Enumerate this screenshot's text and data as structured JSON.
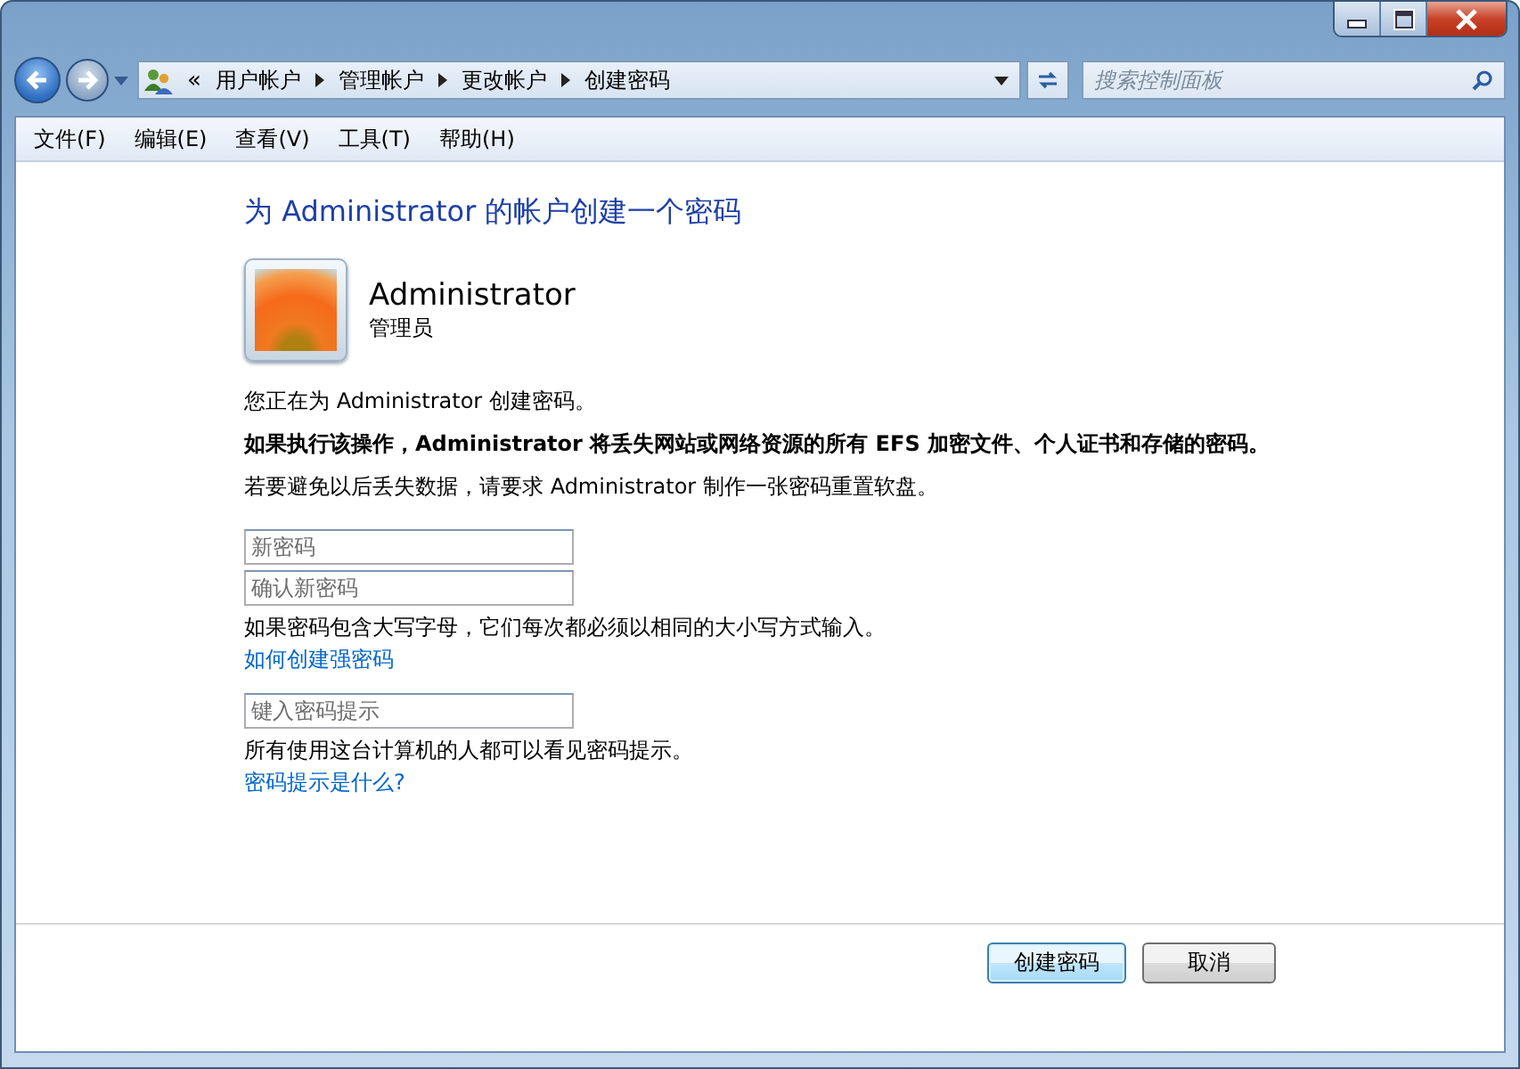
{
  "address_bar": {
    "overflow_mark": "«",
    "breadcrumb": [
      "用户帐户",
      "管理帐户",
      "更改帐户",
      "创建密码"
    ]
  },
  "search": {
    "placeholder": "搜索控制面板"
  },
  "menu": [
    "文件(F)",
    "编辑(E)",
    "查看(V)",
    "工具(T)",
    "帮助(H)"
  ],
  "title": "为 Administrator 的帐户创建一个密码",
  "account": {
    "name": "Administrator",
    "role": "管理员"
  },
  "notes": [
    {
      "text": "您正在为 Administrator 创建密码。",
      "bold": false
    },
    {
      "text": "如果执行该操作，Administrator 将丢失网站或网络资源的所有 EFS 加密文件、个人证书和存储的密码。",
      "bold": true
    },
    {
      "text": "若要避免以后丢失数据，请要求 Administrator 制作一张密码重置软盘。",
      "bold": false
    }
  ],
  "form": [
    {
      "kind": "field",
      "placeholder": "新密码"
    },
    {
      "kind": "field",
      "placeholder": "确认新密码"
    },
    {
      "kind": "hint",
      "text": "如果密码包含大写字母，它们每次都必须以相同的大小写方式输入。"
    },
    {
      "kind": "link",
      "text": "如何创建强密码"
    },
    {
      "kind": "gap"
    },
    {
      "kind": "field",
      "placeholder": "键入密码提示"
    },
    {
      "kind": "hint",
      "text": "所有使用这台计算机的人都可以看见密码提示。"
    },
    {
      "kind": "link",
      "text": "密码提示是什么?"
    }
  ],
  "buttons": [
    {
      "label": "创建密码",
      "default": true
    },
    {
      "label": "取消",
      "default": false
    }
  ]
}
